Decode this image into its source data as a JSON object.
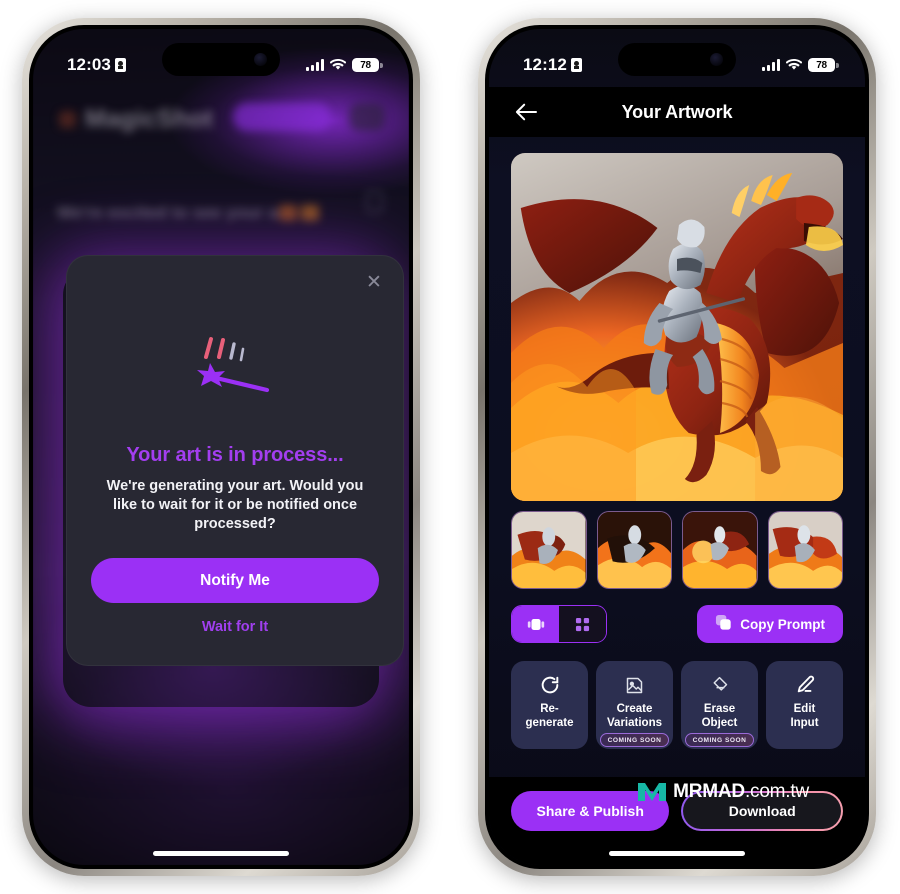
{
  "meta": {
    "watermark_name": "MRMAD",
    "watermark_suffix": ".com.tw"
  },
  "left_phone": {
    "status_bar": {
      "time": "12:03",
      "battery": "78",
      "lock_icon": "lock-icon",
      "wifi_icon": "wifi-icon",
      "signal_icon": "signal-bars-icon"
    },
    "background": {
      "app_title": "MagicShot",
      "subtitle": "We're excited to see your art"
    },
    "modal": {
      "close_icon": "close-icon",
      "wand_icon": "magic-wand-icon",
      "title": "Your art is in process...",
      "body": "We're generating your art. Would you like to wait for it or be notified once processed?",
      "primary_label": "Notify Me",
      "secondary_label": "Wait for It",
      "accent_color": "#9b30f5",
      "title_color": "#a33ef0",
      "surface_color": "#282833"
    }
  },
  "right_phone": {
    "status_bar": {
      "time": "12:12",
      "battery": "78",
      "lock_icon": "lock-icon",
      "wifi_icon": "wifi-icon",
      "signal_icon": "signal-bars-icon"
    },
    "nav": {
      "back_icon": "back-arrow-icon",
      "title": "Your Artwork"
    },
    "hero": {
      "alt": "Knight in silver armor riding a fire-breathing red dragon amid flames"
    },
    "thumbnails": [
      {
        "alt": "Dragon variation 1 - pale sky background"
      },
      {
        "alt": "Dragon variation 2 - dark dragon with flames"
      },
      {
        "alt": "Dragon variation 3 - knight with fire orb"
      },
      {
        "alt": "Dragon variation 4 - red winged dragon"
      }
    ],
    "toolbar": {
      "single_view_icon": "single-image-icon",
      "grid_view_icon": "grid-view-icon",
      "active_view": "single",
      "copy_icon": "copy-icon",
      "copy_label": "Copy Prompt"
    },
    "actions": [
      {
        "icon": "refresh-icon",
        "label": "Re-\ngenerate",
        "label_line1": "Re-",
        "label_line2": "generate",
        "badge": ""
      },
      {
        "icon": "image-variations-icon",
        "label_line1": "Create",
        "label_line2": "Variations",
        "badge": "COMING SOON"
      },
      {
        "icon": "eraser-icon",
        "label_line1": "Erase",
        "label_line2": "Object",
        "badge": "COMING SOON"
      },
      {
        "icon": "pencil-edit-icon",
        "label_line1": "Edit",
        "label_line2": "Input",
        "badge": ""
      }
    ],
    "bottom_bar": {
      "share_label": "Share & Publish",
      "download_label": "Download"
    },
    "colors": {
      "accent": "#9b30f5",
      "card": "#2c2f50",
      "screen_bg": "#0c0e20"
    }
  }
}
